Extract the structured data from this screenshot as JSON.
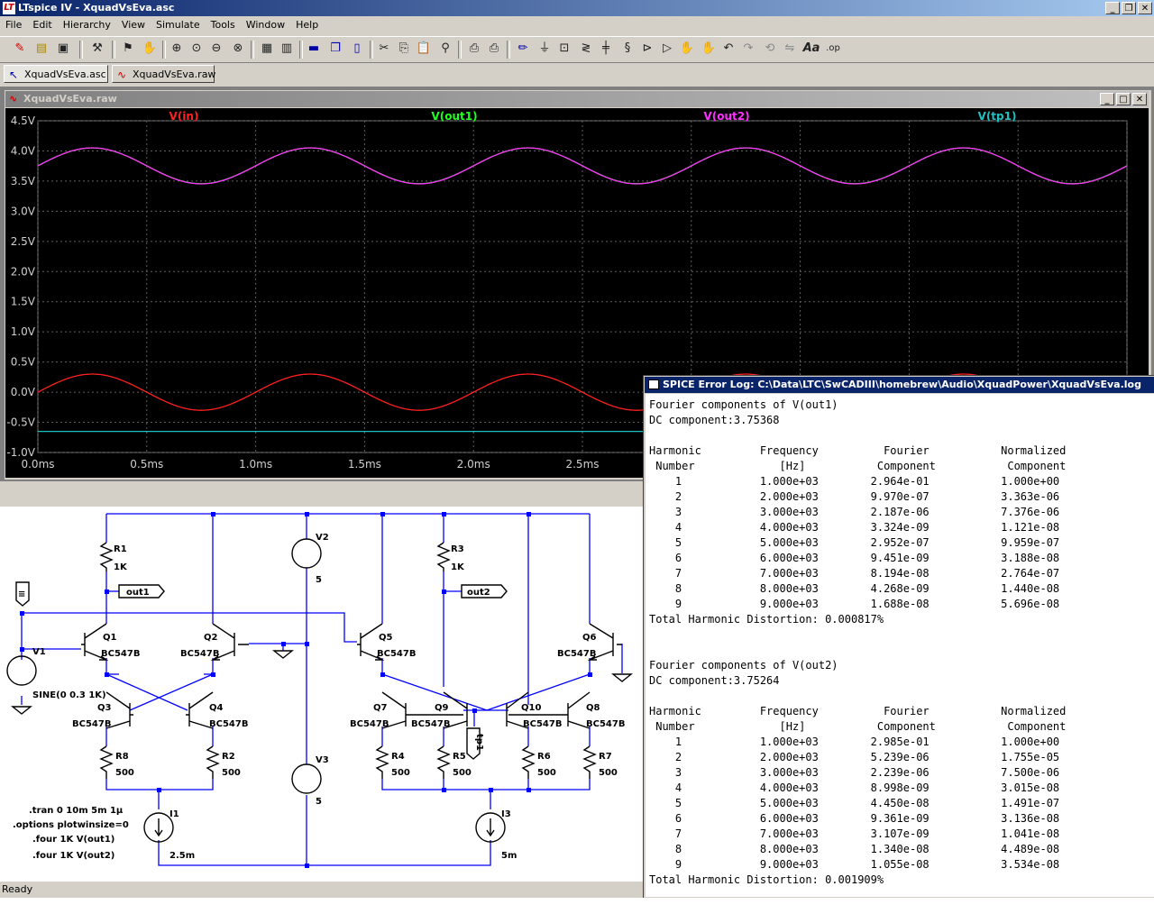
{
  "window": {
    "title": "LTspice IV - XquadVsEva.asc",
    "app_icon": "LT"
  },
  "menu": [
    "File",
    "Edit",
    "Hierarchy",
    "View",
    "Simulate",
    "Tools",
    "Window",
    "Help"
  ],
  "tabs": [
    {
      "label": "XquadVsEva.asc",
      "icon": "schematic-icon"
    },
    {
      "label": "XquadVsEva.raw",
      "icon": "waveform-icon"
    }
  ],
  "plot_window": {
    "title": "XquadVsEva.raw"
  },
  "chart_data": {
    "type": "line",
    "background": "#000000",
    "grid": true,
    "xlabel": "",
    "ylabel": "",
    "x_ticks": [
      "0.0ms",
      "0.5ms",
      "1.0ms",
      "1.5ms",
      "2.0ms",
      "2.5ms"
    ],
    "y_ticks": [
      "4.5V",
      "4.0V",
      "3.5V",
      "3.0V",
      "2.5V",
      "2.0V",
      "1.5V",
      "1.0V",
      "0.5V",
      "0.0V",
      "-0.5V",
      "-1.0V"
    ],
    "xlim": [
      0,
      5
    ],
    "ylim": [
      -1.0,
      4.5
    ],
    "series": [
      {
        "name": "V(in)",
        "color": "#ff2020",
        "kind": "sine",
        "offset": 0.0,
        "amplitude": 0.3,
        "freq_khz": 1,
        "phase_deg": 0
      },
      {
        "name": "V(out1)",
        "color": "#20ff20",
        "kind": "sine",
        "offset": 3.75368,
        "amplitude": 0.2964,
        "freq_khz": 1,
        "phase_deg": 0
      },
      {
        "name": "V(out2)",
        "color": "#ff30ff",
        "kind": "sine",
        "offset": 3.75264,
        "amplitude": 0.2985,
        "freq_khz": 1,
        "phase_deg": 0
      },
      {
        "name": "V(tp1)",
        "color": "#20c0c0",
        "kind": "const",
        "offset": -0.65
      }
    ]
  },
  "schematic": {
    "labels": {
      "R1": "R1",
      "R1v": "1K",
      "R3": "R3",
      "R3v": "1K",
      "out1": "out1",
      "out2": "out2",
      "V2": "V2",
      "V2v": "5",
      "V3": "V3",
      "V3v": "5",
      "V1": "V1",
      "V1v": "SINE(0 0.3 1K)",
      "Q1": "Q1",
      "Q2": "Q2",
      "Q3": "Q3",
      "Q4": "Q4",
      "Q5": "Q5",
      "Q6": "Q6",
      "Q7": "Q7",
      "Q8": "Q8",
      "Q9": "Q9",
      "Q10": "Q10",
      "bc": "BC547B",
      "R2": "R2",
      "R4": "R4",
      "R5": "R5",
      "R6": "R6",
      "R7": "R7",
      "R8": "R8",
      "rv": "500",
      "I1": "I1",
      "I1v": "2.5m",
      "I3": "I3",
      "I3v": "5m",
      "tp1": "tp1",
      "d1": ".tran 0 10m 5m 1μ",
      "d2": ".options plotwinsize=0",
      "d3": ".four 1K V(out1)",
      "d4": ".four 1K V(out2)"
    }
  },
  "log_window": {
    "title": "SPICE Error Log: C:\\Data\\LTC\\SwCADIII\\homebrew\\Audio\\XquadPower\\XquadVsEva.log",
    "lines": [
      "Fourier components of V(out1)",
      "DC component:3.75368",
      "",
      "Harmonic         Frequency          Fourier           Normalized",
      " Number             [Hz]           Component           Component",
      "    1            1.000e+03        2.964e-01           1.000e+00",
      "    2            2.000e+03        9.970e-07           3.363e-06",
      "    3            3.000e+03        2.187e-06           7.376e-06",
      "    4            4.000e+03        3.324e-09           1.121e-08",
      "    5            5.000e+03        2.952e-07           9.959e-07",
      "    6            6.000e+03        9.451e-09           3.188e-08",
      "    7            7.000e+03        8.194e-08           2.764e-07",
      "    8            8.000e+03        4.268e-09           1.440e-08",
      "    9            9.000e+03        1.688e-08           5.696e-08",
      "Total Harmonic Distortion: 0.000817%",
      "",
      "",
      "Fourier components of V(out2)",
      "DC component:3.75264",
      "",
      "Harmonic         Frequency          Fourier           Normalized",
      " Number             [Hz]           Component           Component",
      "    1            1.000e+03        2.985e-01           1.000e+00",
      "    2            2.000e+03        5.239e-06           1.755e-05",
      "    3            3.000e+03        2.239e-06           7.500e-06",
      "    4            4.000e+03        8.998e-09           3.015e-08",
      "    5            5.000e+03        4.450e-08           1.491e-07",
      "    6            6.000e+03        9.361e-09           3.136e-08",
      "    7            7.000e+03        3.107e-09           1.041e-08",
      "    8            8.000e+03        1.340e-08           4.489e-08",
      "    9            9.000e+03        1.055e-08           3.534e-08",
      "Total Harmonic Distortion: 0.001909%"
    ]
  },
  "status": {
    "text": "Ready"
  }
}
